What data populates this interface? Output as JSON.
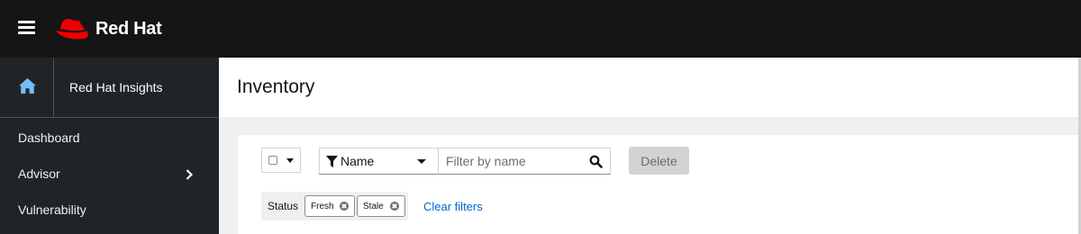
{
  "header": {
    "brand": "Red Hat"
  },
  "sidebar": {
    "title": "Red Hat Insights",
    "items": [
      {
        "label": "Dashboard"
      },
      {
        "label": "Advisor",
        "has_submenu": true
      },
      {
        "label": "Vulnerability"
      }
    ]
  },
  "page": {
    "title": "Inventory"
  },
  "toolbar": {
    "attribute_filter": "Name",
    "search_placeholder": "Filter by name",
    "delete_label": "Delete"
  },
  "filters": {
    "category": "Status",
    "chips": [
      "Fresh",
      "Stale"
    ],
    "clear_label": "Clear filters"
  },
  "colors": {
    "brand_red": "#ee0000",
    "link": "#0066cc",
    "topbar": "#151515",
    "sidebar": "#212427"
  },
  "icons": [
    "hamburger-icon",
    "redhat-logo-icon",
    "home-icon",
    "chevron-right-icon",
    "filter-icon",
    "search-icon",
    "close-icon"
  ]
}
